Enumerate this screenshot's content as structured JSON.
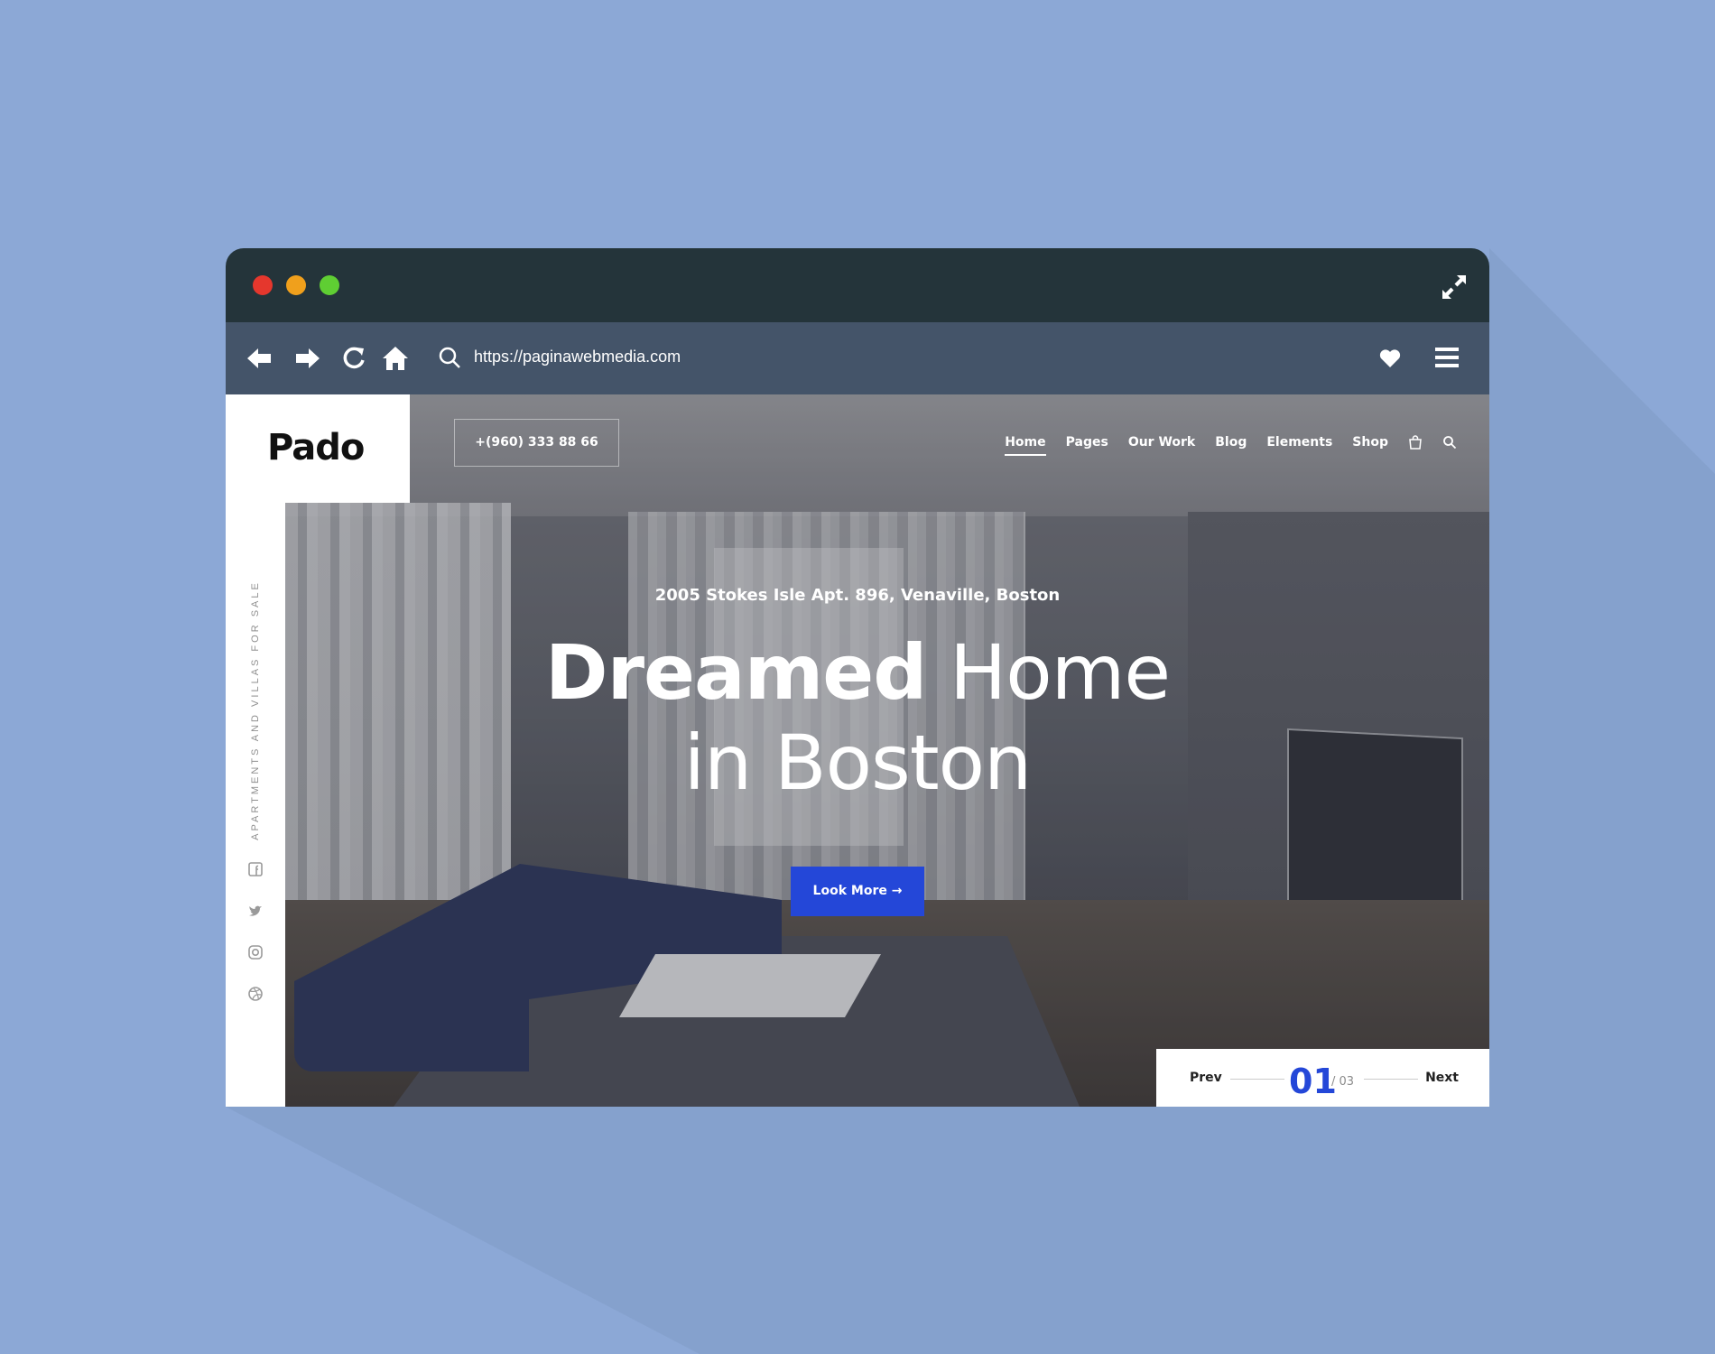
{
  "browser": {
    "url": "https://paginawebmedia.com",
    "icons": [
      "close-dot",
      "minimize-dot",
      "maximize-dot",
      "expand-icon",
      "back-icon",
      "forward-icon",
      "reload-icon",
      "home-icon",
      "search-icon",
      "heart-icon",
      "menu-icon"
    ]
  },
  "site": {
    "logo": "Pado",
    "phone": "+(960) 333 88 66",
    "nav": [
      "Home",
      "Pages",
      "Our Work",
      "Blog",
      "Elements",
      "Shop"
    ],
    "active_nav": "Home",
    "side_text": "APARTMENTS AND VILLAS FOR SALE",
    "social_icons": [
      "facebook-icon",
      "twitter-icon",
      "instagram-icon",
      "dribbble-icon"
    ]
  },
  "hero": {
    "address": "2005 Stokes Isle Apt. 896, Venaville, Boston",
    "headline_bold": "Dreamed",
    "headline_light1": " Home",
    "headline_line2": "in Boston",
    "cta": "Look More →"
  },
  "pager": {
    "prev": "Prev",
    "current": "01",
    "total": "/ 03",
    "next": "Next"
  },
  "colors": {
    "background": "#8ca8d6",
    "titlebar": "#24343a",
    "toolbar": "#445469",
    "accent": "#2447d8"
  }
}
